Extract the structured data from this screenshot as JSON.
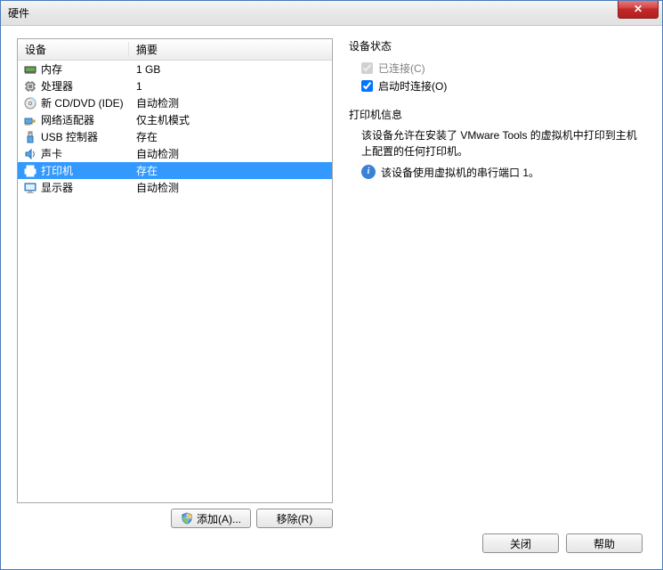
{
  "window": {
    "title": "硬件"
  },
  "list": {
    "headers": {
      "device": "设备",
      "summary": "摘要"
    },
    "rows": [
      {
        "icon": "memory",
        "name": "内存",
        "summary": "1 GB",
        "selected": false
      },
      {
        "icon": "cpu",
        "name": "处理器",
        "summary": "1",
        "selected": false
      },
      {
        "icon": "cd",
        "name": "新 CD/DVD (IDE)",
        "summary": "自动检测",
        "selected": false
      },
      {
        "icon": "nic",
        "name": "网络适配器",
        "summary": "仅主机模式",
        "selected": false
      },
      {
        "icon": "usb",
        "name": "USB 控制器",
        "summary": "存在",
        "selected": false
      },
      {
        "icon": "sound",
        "name": "声卡",
        "summary": "自动检测",
        "selected": false
      },
      {
        "icon": "printer",
        "name": "打印机",
        "summary": "存在",
        "selected": true
      },
      {
        "icon": "display",
        "name": "显示器",
        "summary": "自动检测",
        "selected": false
      }
    ]
  },
  "buttons": {
    "add": "添加(A)...",
    "remove": "移除(R)",
    "close": "关闭",
    "help": "帮助"
  },
  "status": {
    "title": "设备状态",
    "connected": {
      "label": "已连接(C)",
      "checked": true,
      "disabled": true
    },
    "poweron": {
      "label": "启动时连接(O)",
      "checked": true,
      "disabled": false
    }
  },
  "printer_info": {
    "title": "打印机信息",
    "desc": "该设备允许在安装了 VMware Tools 的虚拟机中打印到主机上配置的任何打印机。",
    "note": "该设备使用虚拟机的串行端口 1。"
  }
}
